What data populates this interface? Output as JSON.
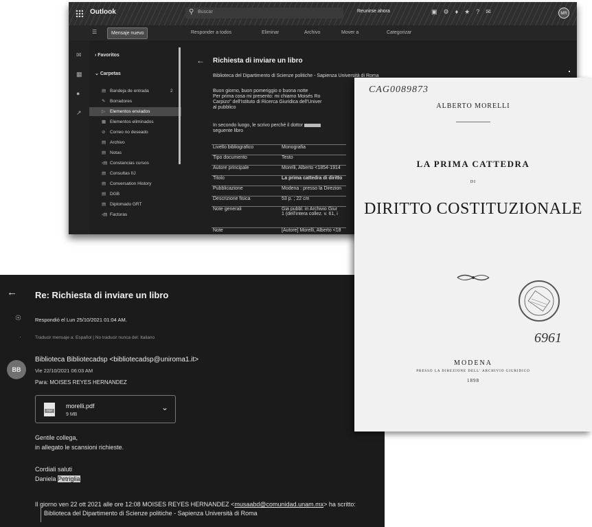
{
  "outlook": {
    "app_name": "Outlook",
    "search_placeholder": "Buscar",
    "meet_now": "Reunirse ahora",
    "avatar_initials": "MR",
    "new_message": "Mensaje nuevo",
    "commands": [
      "Responder a todos",
      "Eliminar",
      "Archivo",
      "Mover a",
      "Categorizar"
    ],
    "favorites": "Favoritos",
    "folders_header": "Carpetas",
    "folders": [
      {
        "label": "Bandeja de entrada",
        "count": "2"
      },
      {
        "label": "Borradores",
        "count": ""
      },
      {
        "label": "Elementos enviados",
        "count": ""
      },
      {
        "label": "Elementos eliminados",
        "count": ""
      },
      {
        "label": "Correo no deseado",
        "count": ""
      },
      {
        "label": "Archivo",
        "count": ""
      },
      {
        "label": "Notas",
        "count": ""
      },
      {
        "label": "Constancias cursos",
        "count": ""
      },
      {
        "label": "Consultas IIJ",
        "count": ""
      },
      {
        "label": "Conversation History",
        "count": ""
      },
      {
        "label": "DGB",
        "count": ""
      },
      {
        "label": "Diplomado GRT",
        "count": ""
      },
      {
        "label": "Facturas",
        "count": ""
      }
    ],
    "subject": "Richiesta di inviare un libro",
    "from": "Biblioteca del Dipartimento di Scienze politiche - Sapienza Università di Roma",
    "body_lines": [
      "Buon giorno, buon pomeriggio o buona notte",
      "Per prima cosa mi presento: mi chiamo Moisés Ro",
      "Carpizo\" dell'Istituto di Ricerca Giuridica dell'Univer",
      "al pubblico"
    ],
    "body_lines_2": [
      "In secondo luogo, le scrivo perché il dottor",
      "seguente libro"
    ],
    "table": [
      {
        "k": "Livello bibliografico",
        "v": "Monografia"
      },
      {
        "k": "Tipo documento",
        "v": "Testo"
      },
      {
        "k": "Autore principale",
        "v": "Morelli, Alberto <1854-1914"
      },
      {
        "k": "Titolo",
        "v": "La prima cattedra di diritto"
      },
      {
        "k": "Pubblicazione",
        "v": "Modena : presso la Direzion"
      },
      {
        "k": "Descrizione fisica",
        "v": "53 p. ; 22 cm"
      },
      {
        "k": "Note generali",
        "v": "Gia pubbl. in Archivio Giur",
        "v2": "1 (dell'intera collez. v. 61, i"
      },
      {
        "k": "Note",
        "v": "[Autore] Morelli, Alberto <18"
      }
    ]
  },
  "reply": {
    "subject": "Re: Richiesta di inviare un libro",
    "replied": "Respondió el Lun 25/10/2021 01:04 AM.",
    "translate": "Traducir mensaje a: Español | No traducir nunca del: Italiano",
    "avatar": "BB",
    "sender": "Biblioteca Bibliotecadsp <bibliotecadsp@uniroma1.it>",
    "date": "Vie 22/10/2021 06:03 AM",
    "to": "Para:  MOISES REYES HERNANDEZ",
    "attachment": {
      "name": "morelli.pdf",
      "size": "9 MB"
    },
    "greeting": "Gentile collega,",
    "line2": "in allegato le scansioni richieste.",
    "closing": "Cordiali saluti",
    "signer_first": "Daniela",
    "signer_last": "Petriglia",
    "quote_header_a": "Il giorno ven 22 ott 2021 alle ore 12:08 MOISES REYES HERNANDEZ <",
    "quote_email": "musaabd@comunidad.unam.mx",
    "quote_header_b": "> ha scritto:",
    "quote_line": "Biblioteca del Dipartimento di Scienze politiche - Sapienza Università di Roma"
  },
  "book": {
    "shelfmark": "CAG0089873",
    "author": "ALBERTO MORELLI",
    "title_1": "LA PRIMA CATTEDRA",
    "title_di": "DI",
    "title_2": "DIRITTO COSTITUZIONALE",
    "handwritten_number": "6961",
    "place": "MODENA",
    "publisher": "PRESSO LA DIREZIONE DELL' ARCHIVIO GIURIDICO",
    "year": "1898"
  }
}
